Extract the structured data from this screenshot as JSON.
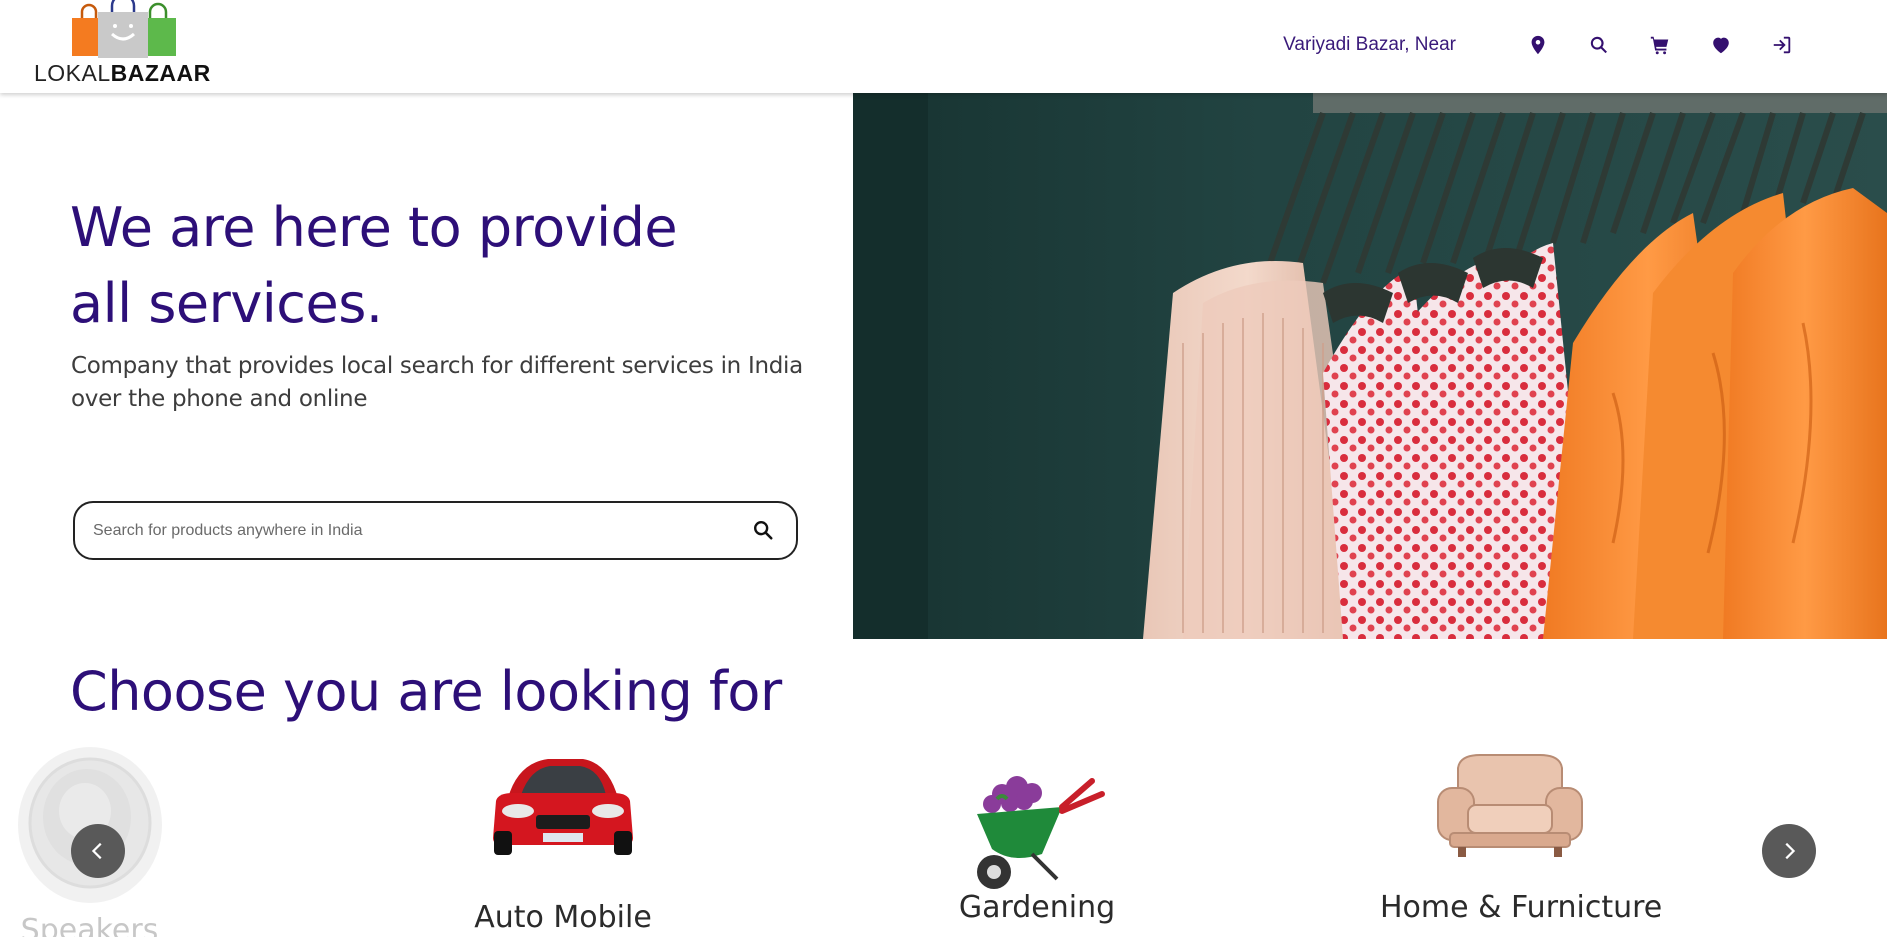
{
  "header": {
    "logo": {
      "part1": "LOKAL",
      "part2": "BAZAAR"
    },
    "location_text": "Variyadi Bazar, Near",
    "icons": [
      "location-pin-icon",
      "search-icon",
      "cart-icon",
      "heart-icon",
      "login-icon"
    ]
  },
  "hero": {
    "title": "We are here to provide\nall services.",
    "subtitle": "Company that provides local search for different services in India over the phone and online",
    "search_placeholder": "Search for products anywhere in India"
  },
  "categories_section": {
    "title": "Choose you are looking for",
    "items": [
      {
        "label": "Speakers"
      },
      {
        "label": "Auto Mobile"
      },
      {
        "label": "Gardening"
      },
      {
        "label": "Home & Furnicture"
      }
    ]
  },
  "colors": {
    "brand_purple": "#2d0f78",
    "nav_icon": "#34106f",
    "carousel_button": "#595959"
  }
}
